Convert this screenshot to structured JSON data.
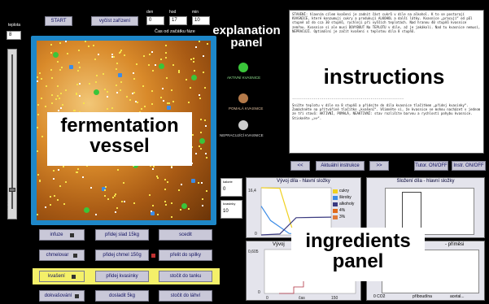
{
  "top": {
    "start_label": "START",
    "read_device_label": "vyčíst zařízení",
    "time_caption": "Čas od začátku fáze",
    "time_units": [
      {
        "label": "den",
        "value": "0"
      },
      {
        "label": "hod",
        "value": "17"
      },
      {
        "label": "min",
        "value": "10"
      }
    ]
  },
  "left_gauge": {
    "label": "teplota",
    "value": "8",
    "scale_label": "teplota"
  },
  "vessel": {
    "annotation": "fermentation vessel",
    "colors": {
      "frame": "#1e87c8",
      "liquid": "#a85a14",
      "glow": "#f2c777"
    }
  },
  "explanation": {
    "annotation": "explanation panel",
    "legend": [
      {
        "label": "AKTIVNÍ KVASNICE",
        "color": "#3ac53a"
      },
      {
        "label": "POMALÁ KVASNICE",
        "color": "#b47a4a"
      },
      {
        "label": "NEPRACUJÍCÍ KVASNICE",
        "color": "#cccccc"
      }
    ]
  },
  "instructions": {
    "annotation": "instructions",
    "text_top": "STAVENÍ: hlavním cílem kvašení je zadnit část cukrů v díle na alkohol. K to se postarají KVASNICE, které konzumují cukry a produkují ALKOHOL a další látky. Kvasnice „pracují“ od půl stupně až do cca 30 stupňů, rychleji při vyšších teplotách. Nad hranou 40 stupňů kvasnice zemřou. Kvasnice si ale musí DOVYBOUT Na TEPLOTU v díle, až je jakákoli. Nad tu kvasnice nemusí, NEPRACUJÍ. Optimální je začít kvašení s teplotou díla 8 stupňů.",
    "divider": "---------------------------------------------------------",
    "text_bottom": "Snižte teplotu v díle na 8 stupňů a přidejte do díla kvasnice tlačítkem „přidej kvasinky“. Zamáchněte na přítvářiné tlačítko „kvašení“. Všimněte si, že kvasnice se mohou nacházet v jednom ze tří stavů: AKTIVNÍ, POMALÁ, NEAKTIVNÍ: stav rozlišíte barvou a rychlostí pohybu kvasnice. Stiskněte „>>“.",
    "nav_prev": "<<",
    "nav_current": "Aktuální instrukce",
    "nav_next": ">>",
    "tutor_label": "Tutor. ON/OFF",
    "instr_label": "Instr. ON/OFF"
  },
  "side_fields": [
    {
      "label": "kalorie",
      "value": "0"
    },
    {
      "label": "kvasinky",
      "value": "10"
    }
  ],
  "ingredients": {
    "annotation": "ingredients panel"
  },
  "buttons": [
    {
      "label": "infuze",
      "has_icon": true,
      "style": "normal"
    },
    {
      "label": "přidej slad 15kg",
      "has_icon": false,
      "style": "normal"
    },
    {
      "label": "scedit",
      "has_icon": false,
      "style": "normal"
    },
    {
      "label": "chmelovar",
      "has_icon": true,
      "style": "normal"
    },
    {
      "label": "přidej chmel 150g",
      "has_icon": true,
      "style": "normal"
    },
    {
      "label": "přelit do spilky",
      "has_icon": false,
      "style": "normal"
    },
    {
      "label": "kvašení",
      "has_icon": true,
      "style": "yellow"
    },
    {
      "label": "přidej kvasinky",
      "has_icon": false,
      "style": "normal"
    },
    {
      "label": "stočit do tanku",
      "has_icon": false,
      "style": "normal"
    },
    {
      "label": "dokvašování",
      "has_icon": true,
      "style": "normal"
    },
    {
      "label": "dosladit 5kg",
      "has_icon": false,
      "style": "normal"
    },
    {
      "label": "stočit do láhví",
      "has_icon": false,
      "style": "normal"
    }
  ],
  "charts": {
    "main_title": "Vývoj díla - hlavní složky",
    "main_yticks": [
      "16,4",
      "0"
    ],
    "legend": [
      {
        "label": "cukry",
        "color": "#f0d020"
      },
      {
        "label": "škroby",
        "color": "#3c8ce6"
      },
      {
        "label": "alkoholy",
        "color": "#3a3a80"
      },
      {
        "label": "4%",
        "color": "#e06a1a"
      },
      {
        "label": "3%",
        "color": "#e07a3a"
      }
    ],
    "composition_title": "Složení díla - hlavní složky",
    "lower_title_fragment": "Vývoj",
    "lower_right_fragment": "- příměsi",
    "lower_yticks": [
      "0,605",
      "0"
    ],
    "lower_xticks": [
      "0",
      "čas",
      "150"
    ],
    "bottom_axis_labels": [
      "0 CO2",
      "příboudína",
      "acetal..."
    ]
  },
  "chart_data": {
    "type": "line",
    "title": "Vývoj díla - hlavní složky",
    "ylim": [
      0,
      16.4
    ],
    "series": [
      {
        "name": "cukry",
        "x": [
          0,
          40,
          70,
          150
        ],
        "y": [
          16.4,
          16.2,
          0.3,
          0.1
        ]
      },
      {
        "name": "škroby",
        "x": [
          0,
          20,
          60,
          150
        ],
        "y": [
          10,
          5,
          0.5,
          0.2
        ]
      },
      {
        "name": "alkoholy",
        "x": [
          0,
          40,
          75,
          150
        ],
        "y": [
          0,
          0.3,
          6.0,
          6.2
        ]
      }
    ]
  }
}
